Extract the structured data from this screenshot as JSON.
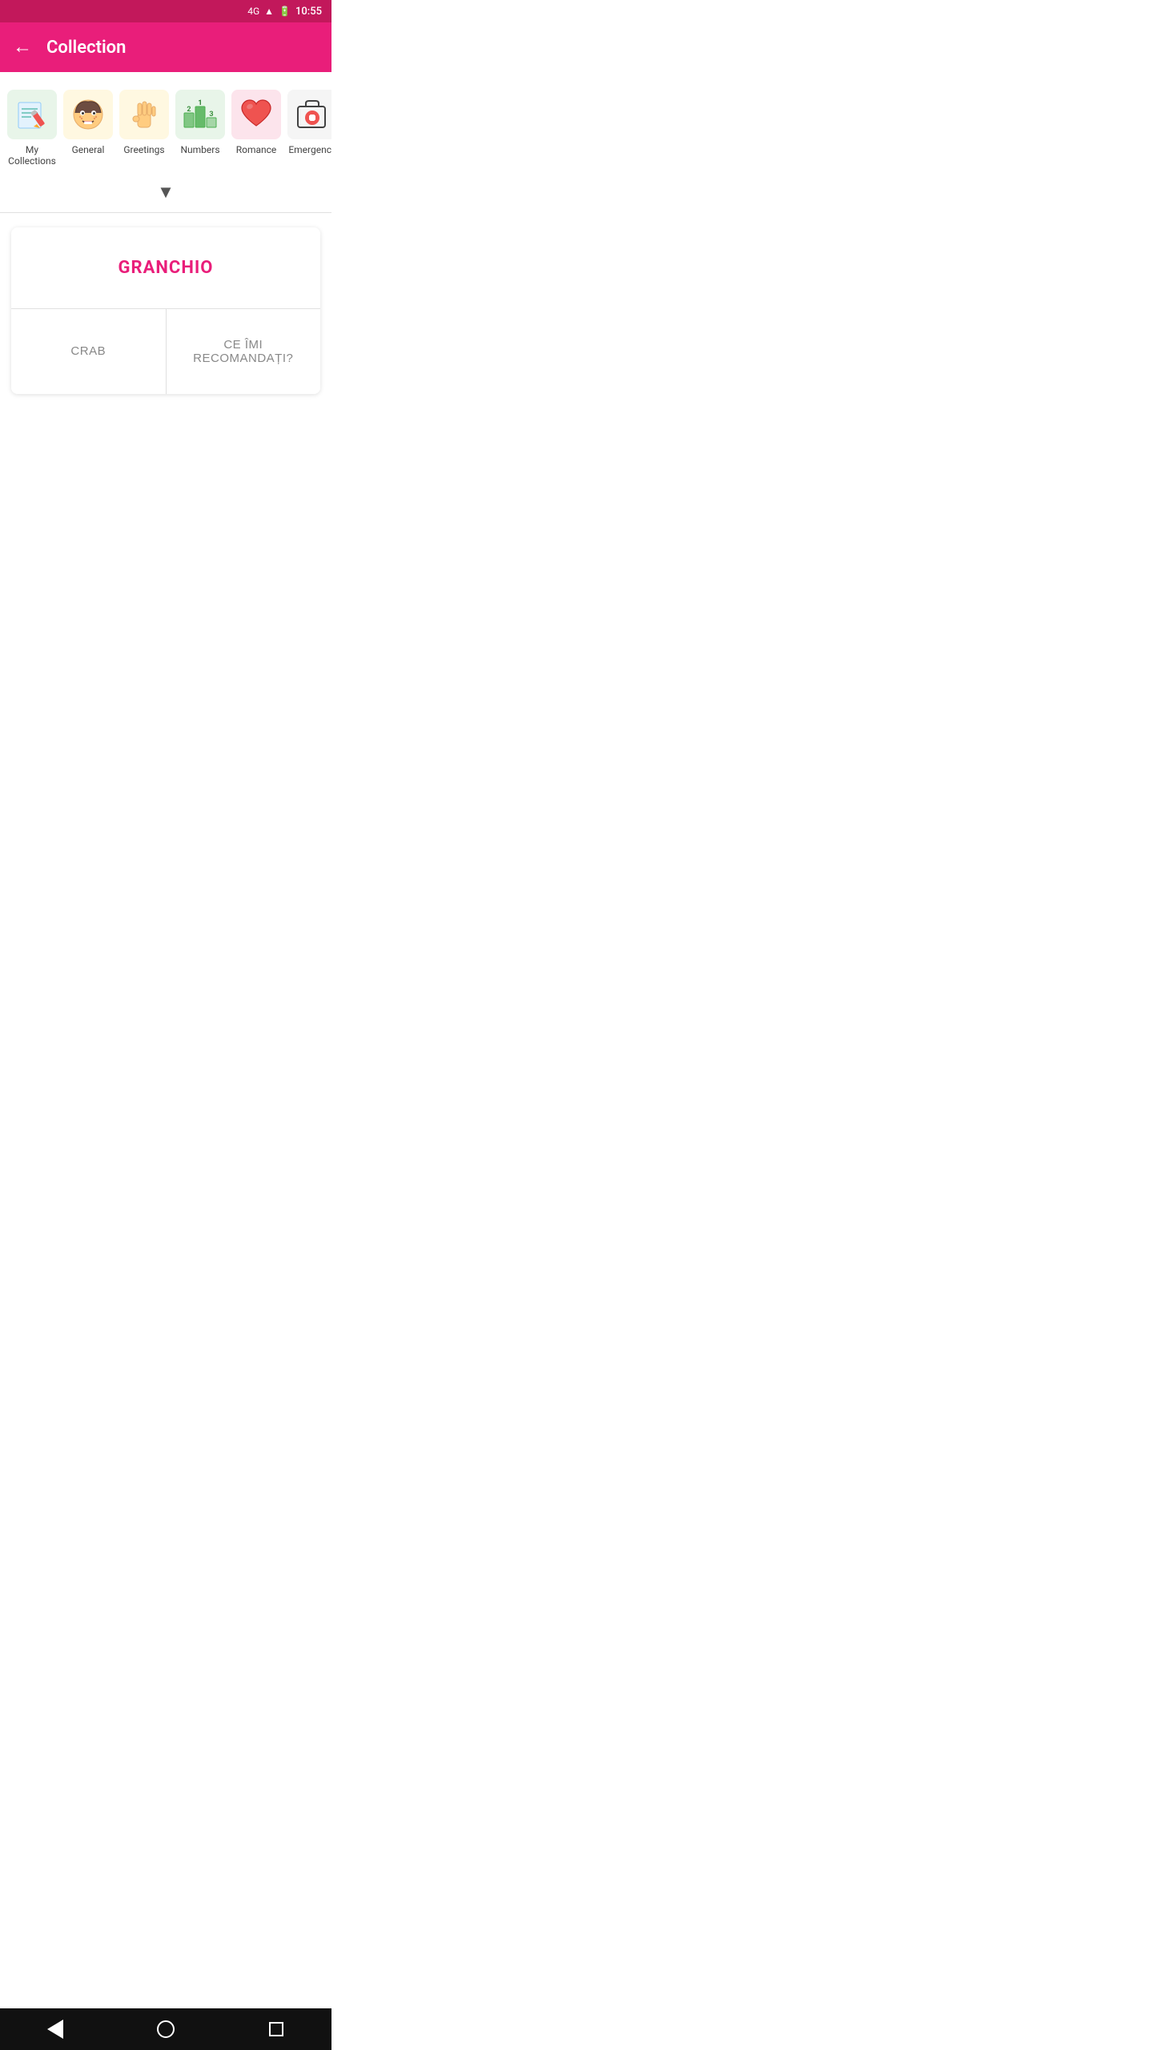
{
  "statusBar": {
    "network": "4G",
    "time": "10:55",
    "batteryIcon": "🔋"
  },
  "appBar": {
    "backLabel": "←",
    "title": "Collection"
  },
  "categories": [
    {
      "id": "my-collections",
      "label": "My Collections",
      "iconType": "pencil"
    },
    {
      "id": "general",
      "label": "General",
      "iconType": "face"
    },
    {
      "id": "greetings",
      "label": "Greetings",
      "iconType": "hand"
    },
    {
      "id": "numbers",
      "label": "Numbers",
      "iconType": "numbers"
    },
    {
      "id": "romance",
      "label": "Romance",
      "iconType": "heart"
    },
    {
      "id": "emergency",
      "label": "Emergency",
      "iconType": "medical"
    }
  ],
  "chevron": "▼",
  "flashcard": {
    "word": "GRANCHIO",
    "answers": [
      {
        "id": "answer-left",
        "text": "CRAB"
      },
      {
        "id": "answer-right",
        "text": "CE ÎMI RECOMANDAȚI?"
      }
    ]
  },
  "bottomNav": {
    "back": "back",
    "home": "home",
    "recent": "recent"
  }
}
